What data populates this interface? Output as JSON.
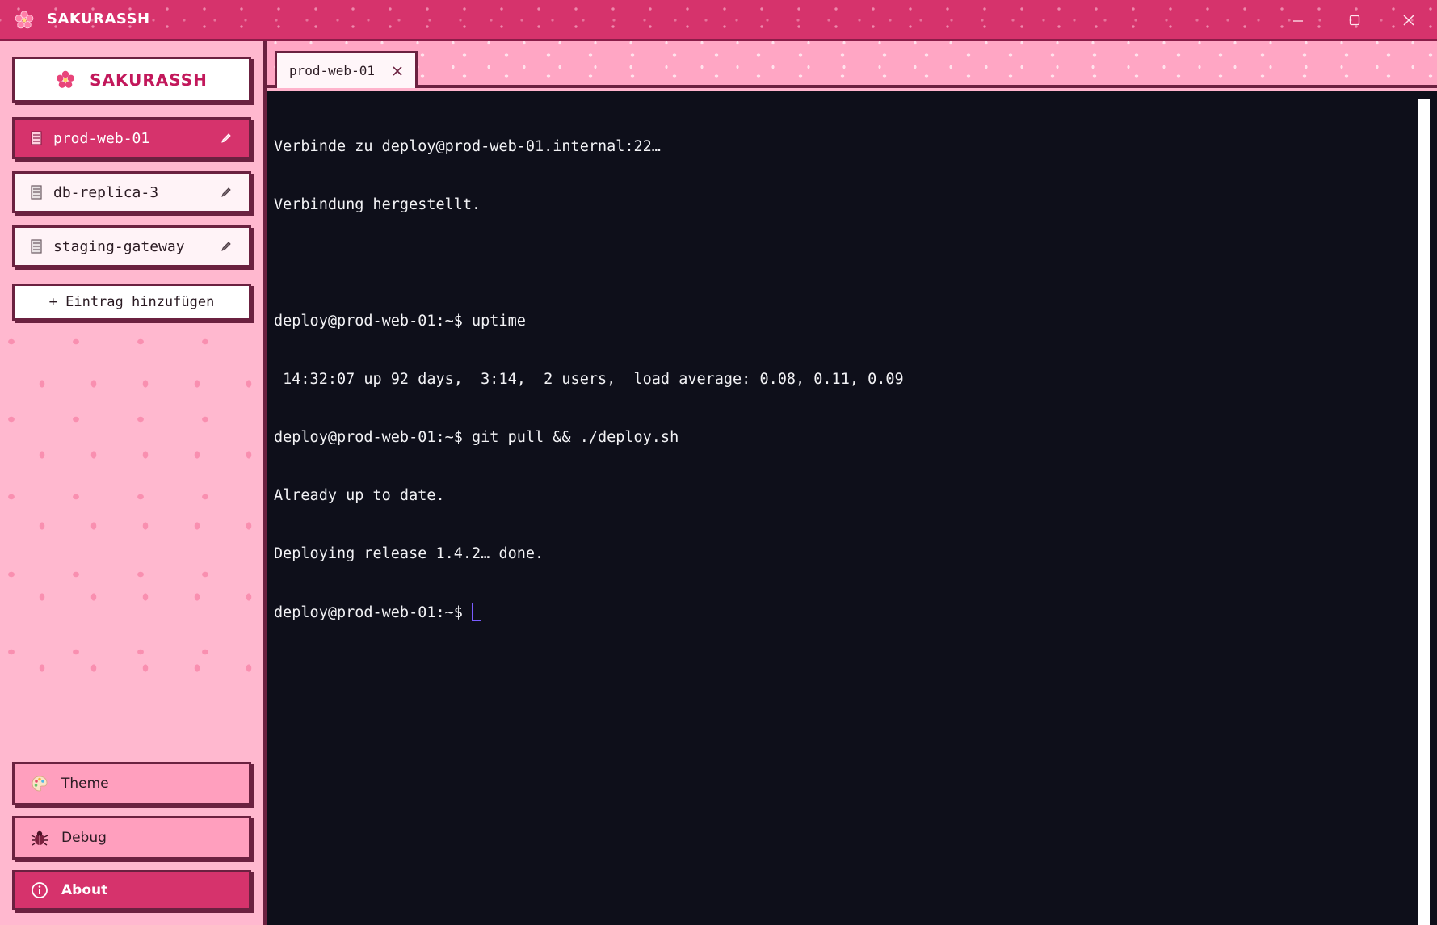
{
  "window": {
    "title": "SAKURASSH",
    "controls": [
      "minimize",
      "maximize",
      "close"
    ]
  },
  "sidebar": {
    "brand": "SAKURASSH",
    "hosts": [
      {
        "label": "prod-web-01",
        "active": true
      },
      {
        "label": "db-replica-3",
        "active": false
      },
      {
        "label": "staging-gateway",
        "active": false
      }
    ],
    "add_entry_label": "+ Eintrag hinzufügen",
    "menu": [
      {
        "label": "Theme",
        "icon": "palette-icon"
      },
      {
        "label": "Debug",
        "icon": "bug-icon"
      },
      {
        "label": "About",
        "icon": "info-icon"
      }
    ]
  },
  "tabs": [
    {
      "label": "prod-web-01",
      "active": true
    }
  ],
  "terminal": {
    "lines": [
      "Verbinde zu deploy@prod-web-01.internal:22…",
      "Verbindung hergestellt.",
      "",
      "deploy@prod-web-01:~$ uptime",
      " 14:32:07 up 92 days,  3:14,  2 users,  load average: 0.08, 0.11, 0.09",
      "deploy@prod-web-01:~$ git pull && ./deploy.sh",
      "Already up to date.",
      "Deploying release 1.4.2… done."
    ],
    "prompt": "deploy@prod-web-01:~$ "
  },
  "colors": {
    "titlebar": "#d6336c",
    "accent": "#d6336c",
    "border": "#6b2140",
    "sidebar_bg": "#ffb8cf",
    "terminal_bg": "#0e0f1a",
    "cursor": "#7a5cff"
  }
}
